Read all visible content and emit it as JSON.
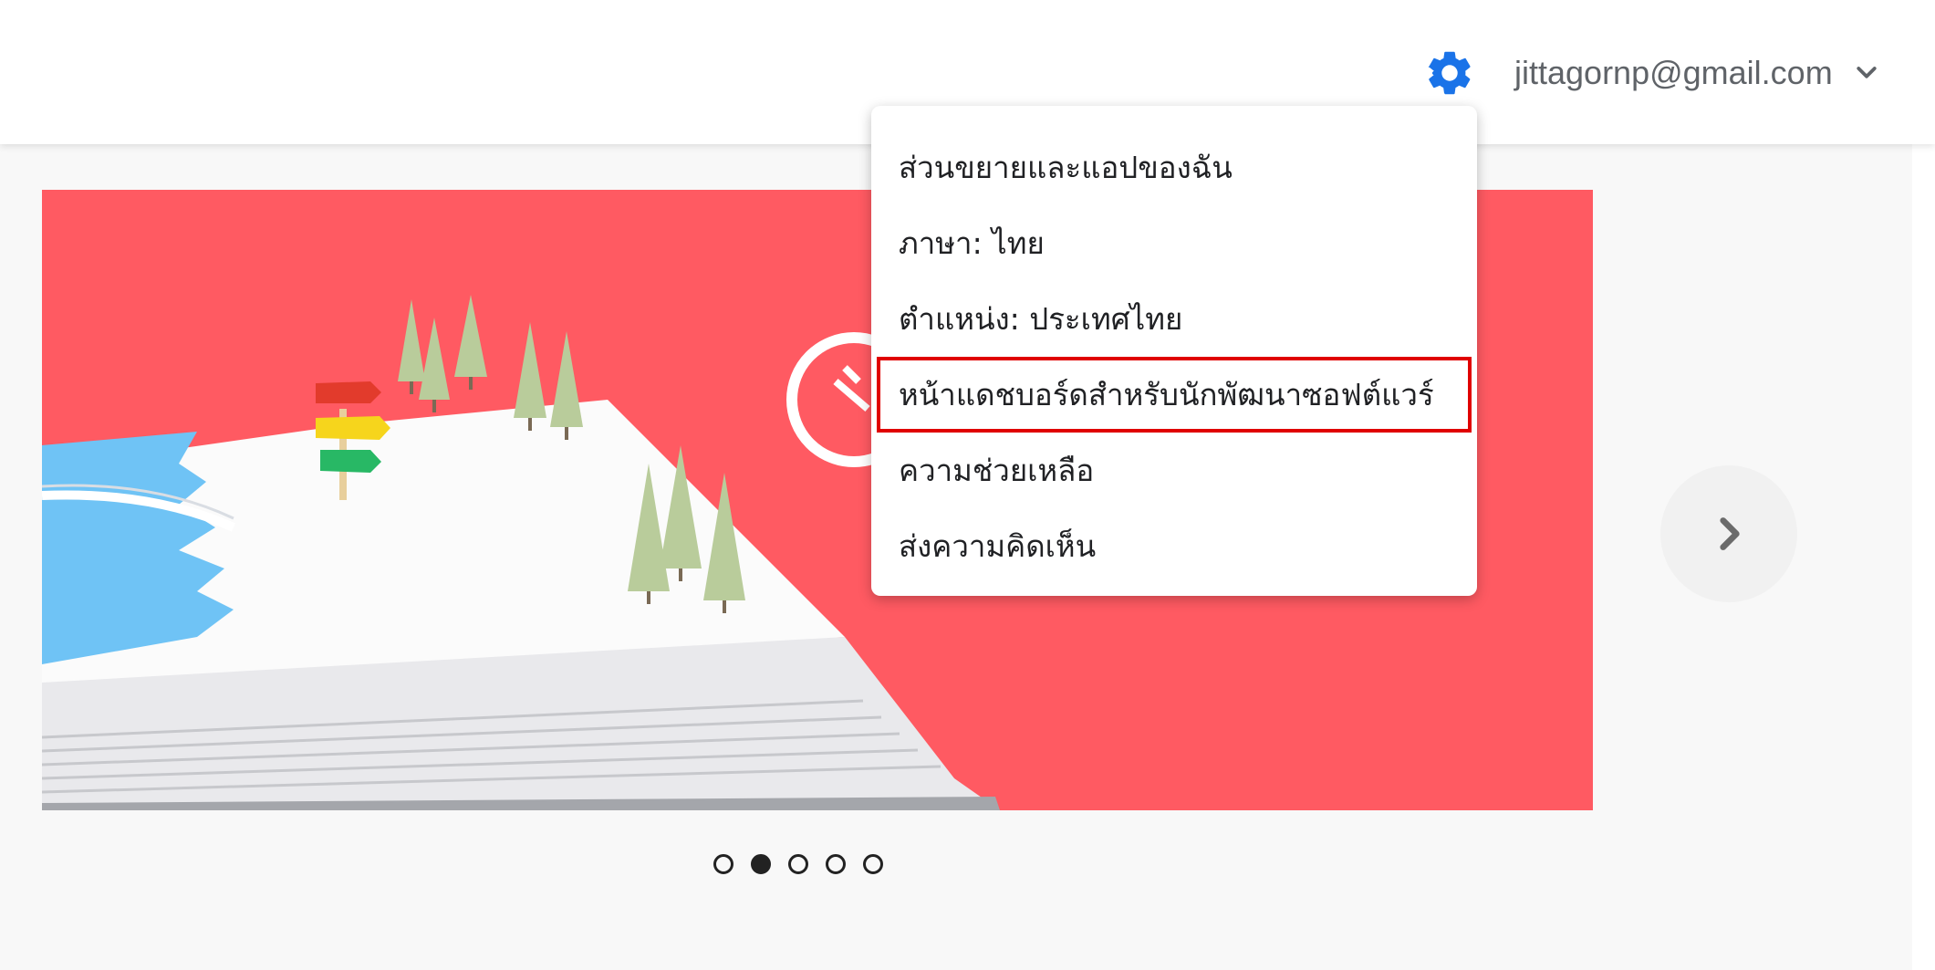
{
  "header": {
    "settings_icon": "gear-icon",
    "account_email": "jittagornp@gmail.com",
    "account_dropdown_icon": "chevron-down-icon"
  },
  "menu": {
    "items": [
      {
        "label": "ส่วนขยายและแอปของฉัน"
      },
      {
        "label": "ภาษา: ไทย"
      },
      {
        "label": "ตำแหน่ง: ประเทศไทย"
      },
      {
        "label": "หน้าแดชบอร์ดสำหรับนักพัฒนาซอฟต์แวร์",
        "highlighted": true
      },
      {
        "label": "ความช่วยเหลือ"
      },
      {
        "label": "ส่งความคิดเห็น"
      }
    ]
  },
  "carousel": {
    "next_icon": "chevron-right-icon",
    "dots": [
      false,
      true,
      false,
      false,
      false
    ],
    "banner_color": "#ff5a62"
  },
  "colors": {
    "accent": "#1a73e8",
    "highlight_border": "#e00000"
  }
}
